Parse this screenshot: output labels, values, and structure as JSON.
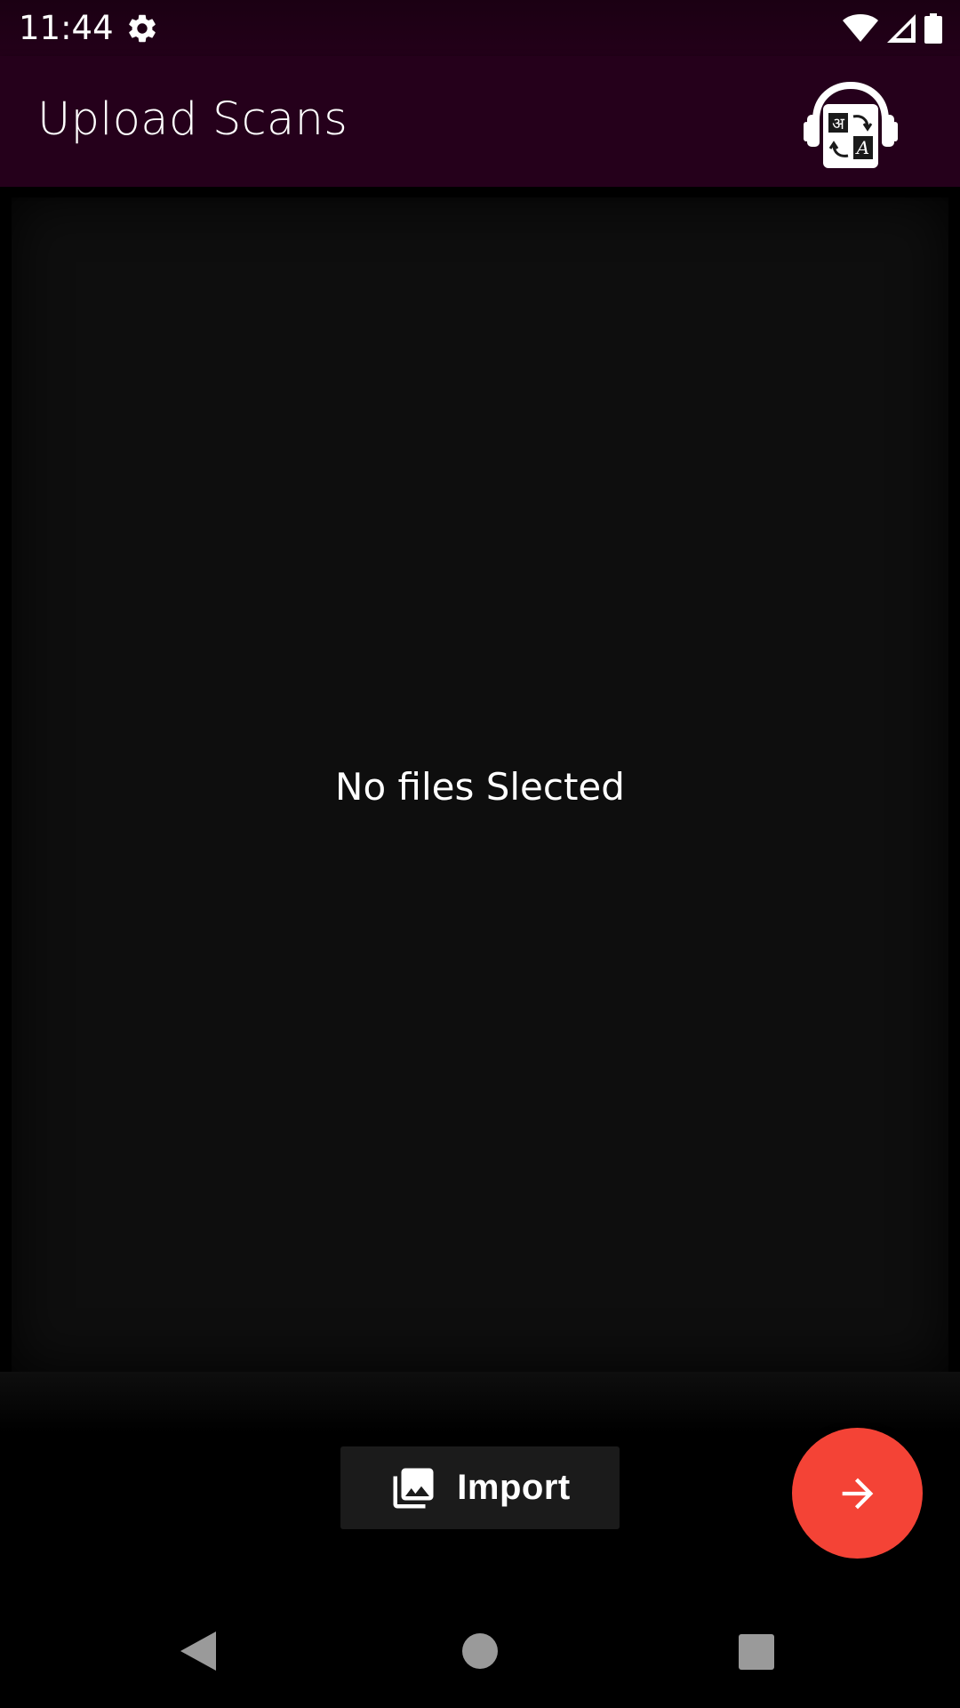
{
  "status_bar": {
    "time": "11:44",
    "icons": [
      "gear-icon",
      "wifi-icon",
      "cell-signal-icon",
      "battery-icon"
    ]
  },
  "app_bar": {
    "title": "Upload Scans",
    "logo_glyphs": [
      "अ",
      "A"
    ],
    "background_color": "#25001b"
  },
  "content": {
    "empty_message": "No files Slected",
    "background_color": "#0e0e0e"
  },
  "import_button": {
    "label": "Import",
    "icon": "photo-library-icon"
  },
  "fab": {
    "icon": "arrow-right-icon",
    "color": "#f44336"
  },
  "nav_bar": {
    "icons": [
      "back-icon",
      "home-icon",
      "recents-icon"
    ]
  }
}
